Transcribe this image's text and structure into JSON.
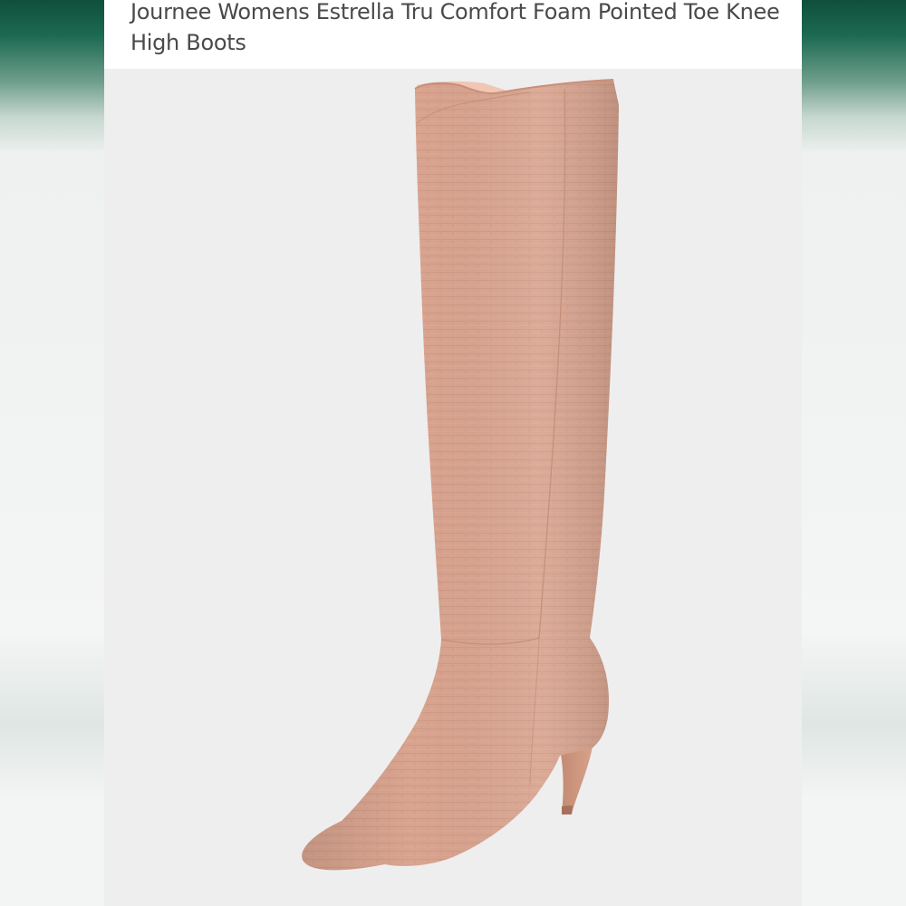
{
  "listing": {
    "title": "Journee Womens Estrella Tru Comfort Foam Pointed Toe Knee High Boots"
  },
  "photo": {
    "subject": "boot-image",
    "boot_color": "#d9a48f",
    "background_color": "#eeeeef"
  }
}
